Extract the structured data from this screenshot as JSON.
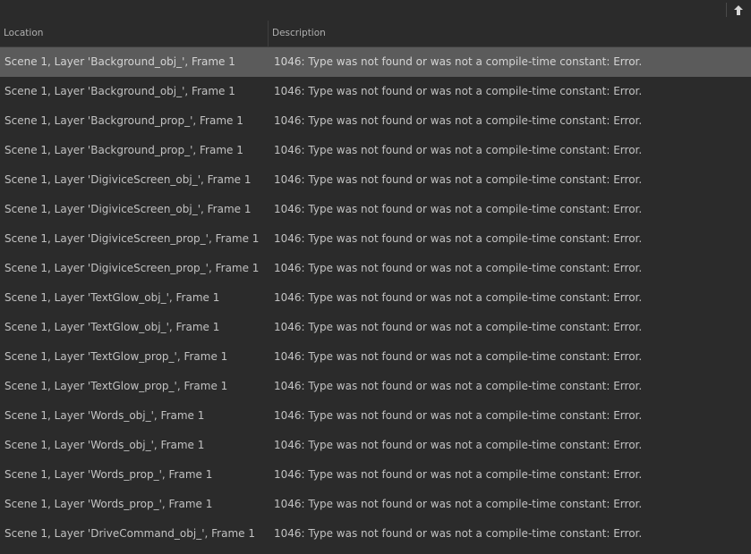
{
  "toolbar": {
    "up_icon": "arrow-up-icon"
  },
  "columns": {
    "location": "Location",
    "description": "Description"
  },
  "colors": {
    "background": "#2b2b2b",
    "selected_row": "#5b5b5b",
    "text": "#c2c2c2"
  },
  "rows": [
    {
      "location": "Scene 1, Layer 'Background_obj_', Frame 1",
      "description": "1046: Type was not found or was not a compile-time constant: Error.",
      "selected": true
    },
    {
      "location": "Scene 1, Layer 'Background_obj_', Frame 1",
      "description": "1046: Type was not found or was not a compile-time constant: Error."
    },
    {
      "location": "Scene 1, Layer 'Background_prop_', Frame 1",
      "description": "1046: Type was not found or was not a compile-time constant: Error."
    },
    {
      "location": "Scene 1, Layer 'Background_prop_', Frame 1",
      "description": "1046: Type was not found or was not a compile-time constant: Error."
    },
    {
      "location": "Scene 1, Layer 'DigiviceScreen_obj_', Frame 1",
      "description": "1046: Type was not found or was not a compile-time constant: Error."
    },
    {
      "location": "Scene 1, Layer 'DigiviceScreen_obj_', Frame 1",
      "description": "1046: Type was not found or was not a compile-time constant: Error."
    },
    {
      "location": "Scene 1, Layer 'DigiviceScreen_prop_', Frame 1",
      "description": "1046: Type was not found or was not a compile-time constant: Error."
    },
    {
      "location": "Scene 1, Layer 'DigiviceScreen_prop_', Frame 1",
      "description": "1046: Type was not found or was not a compile-time constant: Error."
    },
    {
      "location": "Scene 1, Layer 'TextGlow_obj_', Frame 1",
      "description": "1046: Type was not found or was not a compile-time constant: Error."
    },
    {
      "location": "Scene 1, Layer 'TextGlow_obj_', Frame 1",
      "description": "1046: Type was not found or was not a compile-time constant: Error."
    },
    {
      "location": "Scene 1, Layer 'TextGlow_prop_', Frame 1",
      "description": "1046: Type was not found or was not a compile-time constant: Error."
    },
    {
      "location": "Scene 1, Layer 'TextGlow_prop_', Frame 1",
      "description": "1046: Type was not found or was not a compile-time constant: Error."
    },
    {
      "location": "Scene 1, Layer 'Words_obj_', Frame 1",
      "description": "1046: Type was not found or was not a compile-time constant: Error."
    },
    {
      "location": "Scene 1, Layer 'Words_obj_', Frame 1",
      "description": "1046: Type was not found or was not a compile-time constant: Error."
    },
    {
      "location": "Scene 1, Layer 'Words_prop_', Frame 1",
      "description": "1046: Type was not found or was not a compile-time constant: Error."
    },
    {
      "location": "Scene 1, Layer 'Words_prop_', Frame 1",
      "description": "1046: Type was not found or was not a compile-time constant: Error."
    },
    {
      "location": "Scene 1, Layer 'DriveCommand_obj_', Frame 1",
      "description": "1046: Type was not found or was not a compile-time constant: Error."
    }
  ]
}
